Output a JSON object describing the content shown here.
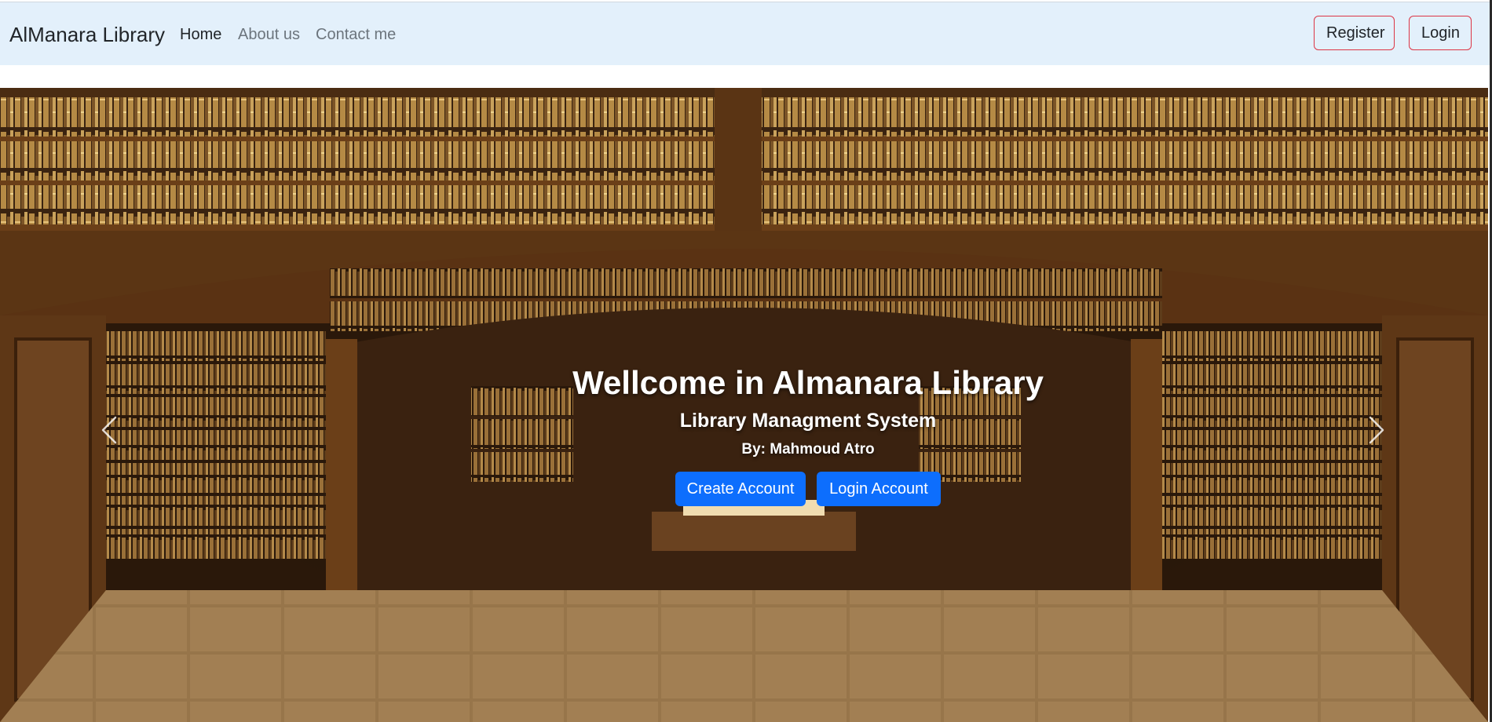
{
  "navbar": {
    "brand": "AlManara Library",
    "links": [
      {
        "label": "Home",
        "active": true
      },
      {
        "label": "About us",
        "active": false
      },
      {
        "label": "Contact me",
        "active": false
      }
    ],
    "register_label": "Register",
    "login_label": "Login"
  },
  "hero": {
    "title": "Wellcome in Almanara Library",
    "subtitle": "Library Managment System",
    "author": "By: Mahmoud Atro",
    "create_account_label": "Create Account",
    "login_account_label": "Login Account",
    "prev_icon": "chevron-left-icon",
    "next_icon": "chevron-right-icon"
  },
  "colors": {
    "navbar_bg": "#e3f0fb",
    "primary": "#0d6efd",
    "outline_danger": "#dc3545",
    "text": "#212529",
    "muted": "#6c757d"
  }
}
